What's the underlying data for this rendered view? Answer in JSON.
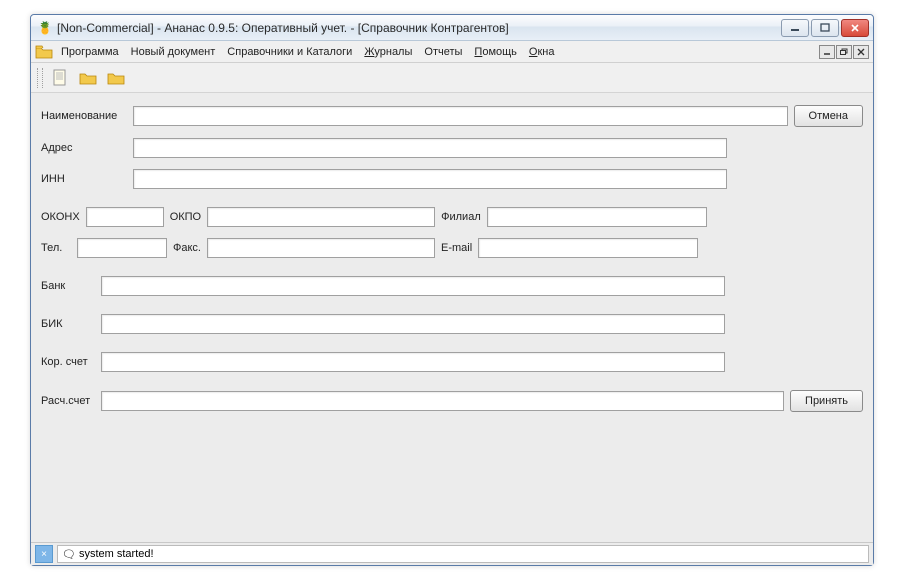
{
  "window": {
    "title": "[Non-Commercial] - Ананас 0.9.5: Оперативный учет. - [Справочник Контрагентов]"
  },
  "menu": {
    "program": "Программа",
    "new_doc": "Новый документ",
    "catalogs": "Справочники и Каталоги",
    "journals": "Журналы",
    "reports": "Отчеты",
    "help": "Помощь",
    "windows": "Окна"
  },
  "form": {
    "labels": {
      "name": "Наименование",
      "address": "Адрес",
      "inn": "ИНН",
      "okonh": "ОКОНХ",
      "okpo": "ОКПО",
      "branch": "Филиал",
      "tel": "Тел.",
      "fax": "Факс.",
      "email": "E-mail",
      "bank": "Банк",
      "bik": "БИК",
      "corr": "Кор. счет",
      "rasch": "Расч.счет"
    },
    "values": {
      "name": "",
      "address": "",
      "inn": "",
      "okonh": "",
      "okpo": "",
      "branch": "",
      "tel": "",
      "fax": "",
      "email": "",
      "bank": "",
      "bik": "",
      "corr": "",
      "rasch": ""
    },
    "buttons": {
      "cancel": "Отмена",
      "accept": "Принять"
    }
  },
  "status": {
    "message": "system started!"
  }
}
